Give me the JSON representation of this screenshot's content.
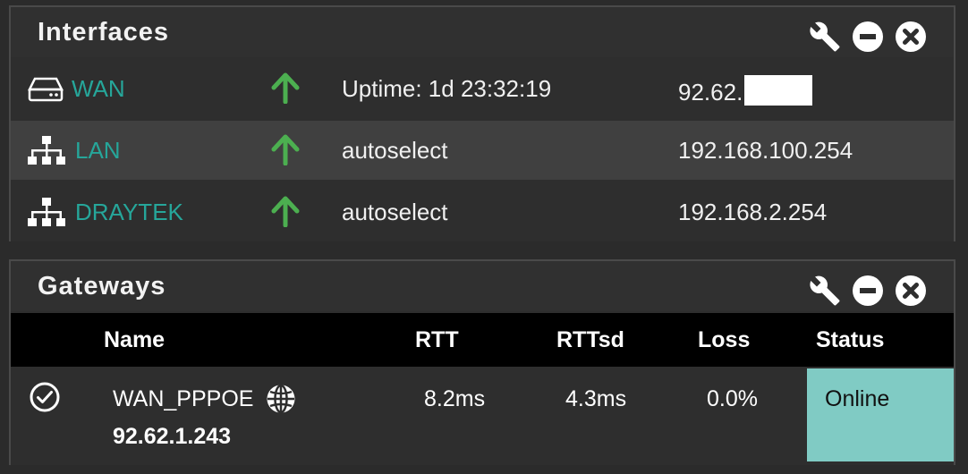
{
  "interfaces": {
    "title": "Interfaces",
    "rows": [
      {
        "name": "WAN",
        "icon": "router-icon",
        "status_icon": "arrow-up-icon",
        "info": "Uptime: 1d 23:32:19",
        "ip_prefix": "92.62."
      },
      {
        "name": "LAN",
        "icon": "network-icon",
        "status_icon": "arrow-up-icon",
        "info": "autoselect",
        "ip": "192.168.100.254"
      },
      {
        "name": "DRAYTEK",
        "icon": "network-icon",
        "status_icon": "arrow-up-icon",
        "info": "autoselect",
        "ip": "192.168.2.254"
      }
    ]
  },
  "gateways": {
    "title": "Gateways",
    "columns": [
      "Name",
      "RTT",
      "RTTsd",
      "Loss",
      "Status"
    ],
    "rows": [
      {
        "name": "WAN_PPPOE",
        "address": "92.62.1.243",
        "rtt": "8.2ms",
        "rttsd": "4.3ms",
        "loss": "0.0%",
        "status": "Online"
      }
    ]
  },
  "colors": {
    "link": "#26a69a",
    "arrow_up": "#4caf50",
    "status_online": "#80cbc4",
    "header_bg": "#000000"
  }
}
